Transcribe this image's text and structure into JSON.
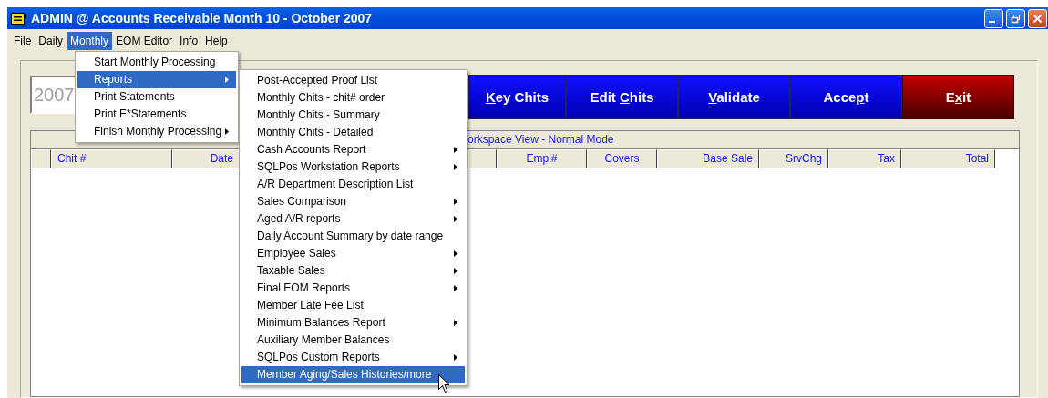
{
  "window": {
    "title": "ADMIN @ Accounts Receivable Month 10 - October 2007"
  },
  "menu_bar": [
    {
      "label": "File",
      "selected": false
    },
    {
      "label": "Daily",
      "selected": false
    },
    {
      "label": "Monthly",
      "selected": true
    },
    {
      "label": "EOM Editor",
      "selected": false
    },
    {
      "label": "Info",
      "selected": false
    },
    {
      "label": "Help",
      "selected": false
    }
  ],
  "monthly_menu": [
    {
      "label": "Start Monthly Processing",
      "has_submenu": false,
      "selected": false
    },
    {
      "label": "Reports",
      "has_submenu": true,
      "selected": true
    },
    {
      "label": "Print Statements",
      "has_submenu": false,
      "selected": false
    },
    {
      "label": "Print E*Statements",
      "has_submenu": false,
      "selected": false
    },
    {
      "label": "Finish Monthly Processing",
      "has_submenu": true,
      "selected": false
    }
  ],
  "reports_submenu": [
    {
      "label": "Post-Accepted Proof List",
      "has_submenu": false,
      "selected": false
    },
    {
      "label": "Monthly Chits - chit# order",
      "has_submenu": false,
      "selected": false
    },
    {
      "label": "Monthly Chits - Summary",
      "has_submenu": false,
      "selected": false
    },
    {
      "label": "Monthly Chits - Detailed",
      "has_submenu": false,
      "selected": false
    },
    {
      "label": "Cash Accounts Report",
      "has_submenu": true,
      "selected": false
    },
    {
      "label": "SQLPos Workstation Reports",
      "has_submenu": true,
      "selected": false
    },
    {
      "label": "A/R Department Description List",
      "has_submenu": false,
      "selected": false
    },
    {
      "label": "Sales Comparison",
      "has_submenu": true,
      "selected": false
    },
    {
      "label": "Aged A/R reports",
      "has_submenu": true,
      "selected": false
    },
    {
      "label": "Daily Account Summary by date range",
      "has_submenu": false,
      "selected": false
    },
    {
      "label": "Employee Sales",
      "has_submenu": true,
      "selected": false
    },
    {
      "label": "Taxable Sales",
      "has_submenu": true,
      "selected": false
    },
    {
      "label": "Final EOM Reports",
      "has_submenu": true,
      "selected": false
    },
    {
      "label": "Member Late Fee List",
      "has_submenu": false,
      "selected": false
    },
    {
      "label": "Minimum Balances Report",
      "has_submenu": true,
      "selected": false
    },
    {
      "label": "Auxiliary Member Balances",
      "has_submenu": false,
      "selected": false
    },
    {
      "label": "SQLPos Custom Reports",
      "has_submenu": true,
      "selected": false
    },
    {
      "label": "Member Aging/Sales Histories/more",
      "has_submenu": false,
      "selected": true
    }
  ],
  "period_field": {
    "value": "2007"
  },
  "buttons": [
    {
      "kind": "primary",
      "key": "K",
      "after": "ey Chits"
    },
    {
      "kind": "primary",
      "before": "Edit ",
      "key": "C",
      "after": "hits"
    },
    {
      "kind": "primary",
      "key": "V",
      "after": "alidate"
    },
    {
      "kind": "primary",
      "before": "Acce",
      "key": "p",
      "after": "t"
    },
    {
      "kind": "danger",
      "before": "E",
      "key": "x",
      "after": "it"
    }
  ],
  "workspace": {
    "title": "orkspace View - Normal Mode",
    "columns": [
      "Chit #",
      "Date",
      "Empl#",
      "Covers",
      "Base Sale",
      "SrvChg",
      "Tax",
      "Total"
    ]
  }
}
